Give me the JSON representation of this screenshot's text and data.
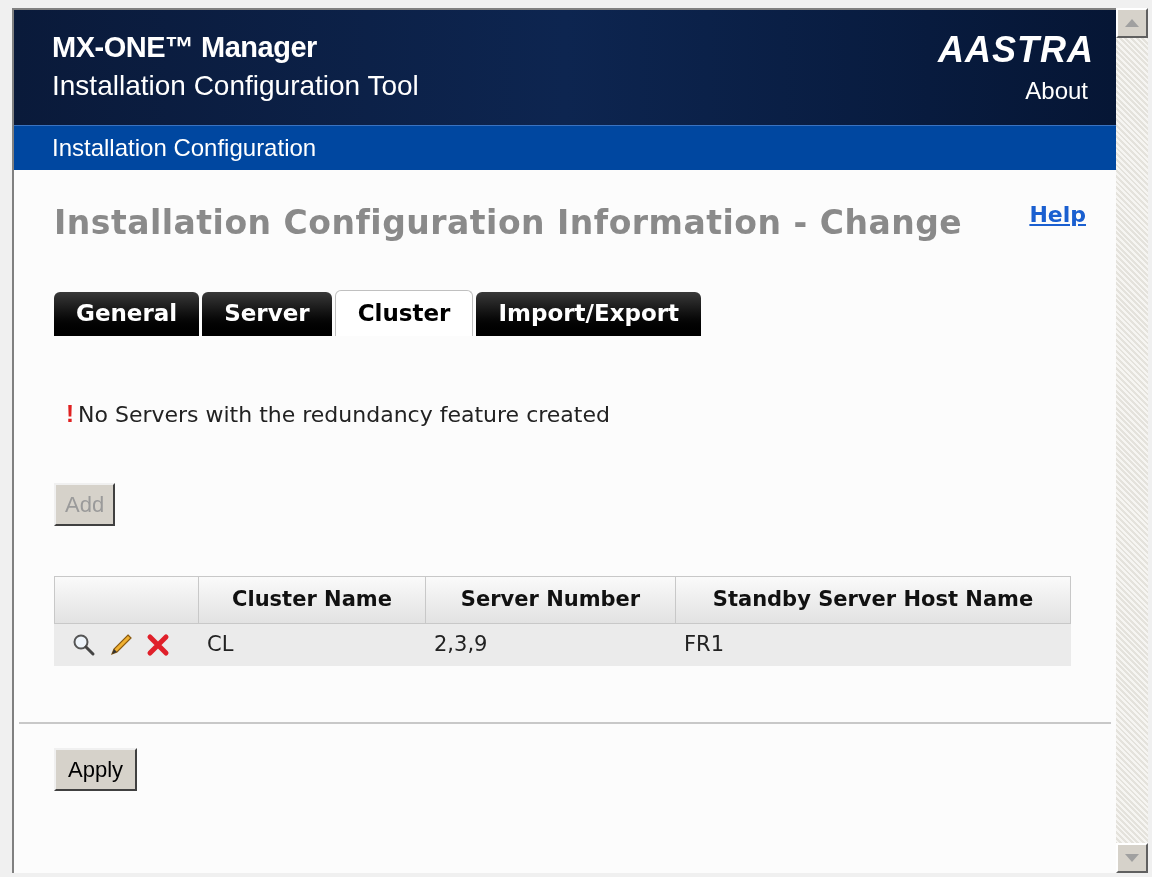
{
  "header": {
    "product": "MX-ONE™ Manager",
    "subtitle": "Installation Configuration Tool",
    "logo": "AASTRA",
    "about": "About"
  },
  "nav_bar": {
    "label": "Installation Configuration"
  },
  "page": {
    "title": "Installation Configuration Information - Change",
    "help": "Help"
  },
  "tabs": [
    {
      "label": "General",
      "selected": false
    },
    {
      "label": "Server",
      "selected": false
    },
    {
      "label": "Cluster",
      "selected": true
    },
    {
      "label": "Import/Export",
      "selected": false
    }
  ],
  "message": {
    "icon": "!",
    "text": "No Servers with the redundancy feature created"
  },
  "add_button": {
    "label": "Add",
    "disabled": true
  },
  "table": {
    "columns": [
      "Cluster Name",
      "Server Number",
      "Standby Server Host Name"
    ],
    "rows": [
      {
        "cells": [
          "CL",
          "2,3,9",
          "FR1"
        ]
      }
    ]
  },
  "apply_button": {
    "label": "Apply",
    "disabled": false
  }
}
